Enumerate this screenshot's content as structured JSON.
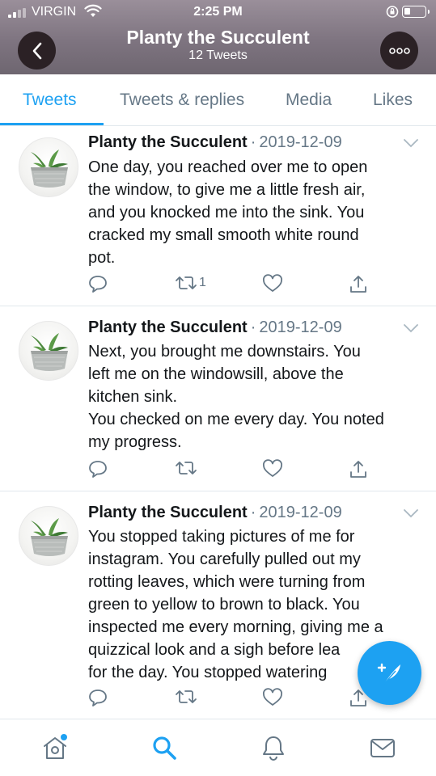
{
  "status_bar": {
    "carrier": "VIRGIN",
    "time": "2:25 PM"
  },
  "header": {
    "title": "Planty the Succulent",
    "subtitle": "12 Tweets"
  },
  "tabs": [
    {
      "label": "Tweets",
      "active": true
    },
    {
      "label": "Tweets & replies",
      "active": false
    },
    {
      "label": "Media",
      "active": false
    },
    {
      "label": "Likes",
      "active": false
    }
  ],
  "tweets": [
    {
      "name": "Planty the Succulent",
      "separator": "·",
      "date": "2019-12-09",
      "lines": [
        "One day, you reached over me to open",
        "the window, to give me a little fresh air,",
        "and you knocked me into the sink. You",
        "cracked my small smooth white round",
        "pot."
      ],
      "retweet_count": "1"
    },
    {
      "name": "Planty the Succulent",
      "separator": "·",
      "date": "2019-12-09",
      "lines": [
        "Next, you brought me downstairs. You",
        "left me on the windowsill, above the",
        "kitchen sink.",
        "You checked on me every day. You noted",
        "my progress."
      ],
      "retweet_count": ""
    },
    {
      "name": "Planty the Succulent",
      "separator": "·",
      "date": "2019-12-09",
      "lines": [
        "You stopped taking pictures of me for",
        "instagram. You carefully pulled out my",
        "rotting leaves, which were turning from",
        "green to yellow to brown to black. You",
        "inspected me every morning, giving me a",
        "quizzical look and a sigh before lea",
        "for the day. You stopped watering"
      ],
      "retweet_count": ""
    }
  ],
  "icons": {
    "back": "chevron-left-icon",
    "more": "more-dots-icon",
    "reply": "reply-icon",
    "retweet": "retweet-icon",
    "like": "heart-icon",
    "share": "share-icon",
    "compose": "compose-tweet-icon",
    "home": "home-icon",
    "search": "search-icon",
    "notifications": "bell-icon",
    "messages": "mail-icon"
  },
  "colors": {
    "accent": "#1da1f2",
    "text": "#14171a",
    "muted": "#657786",
    "header_bg": "#7e7480",
    "button_bg": "#2b2125"
  }
}
